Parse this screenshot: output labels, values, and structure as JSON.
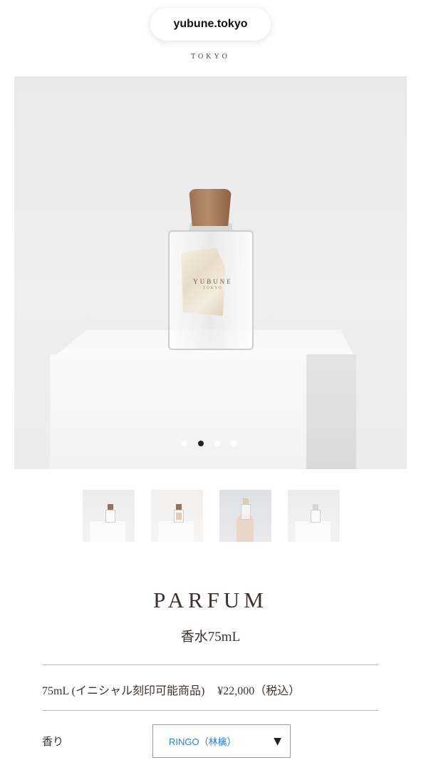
{
  "browser": {
    "url": "yubune.tokyo"
  },
  "brand": {
    "sub": "TOKYO"
  },
  "gallery": {
    "bottle_label": "YUBUNE",
    "bottle_label_sub": "TOKYO",
    "slide_count": 4,
    "active_slide": 2,
    "thumbnail_count": 4,
    "selected_thumbnail": 3
  },
  "product": {
    "name": "PARFUM",
    "subtitle": "香水75mL",
    "variant": "75mL (イニシャル刻印可能商品)",
    "price": "¥22,000（税込）"
  },
  "options": {
    "scent_label": "香り",
    "scent_value": "RINGO（林檎）",
    "arrow": "▼"
  },
  "colors": {
    "select_text": "#2f7fc4",
    "active_dot": "#222222",
    "cap_wood": "#9c7052"
  }
}
